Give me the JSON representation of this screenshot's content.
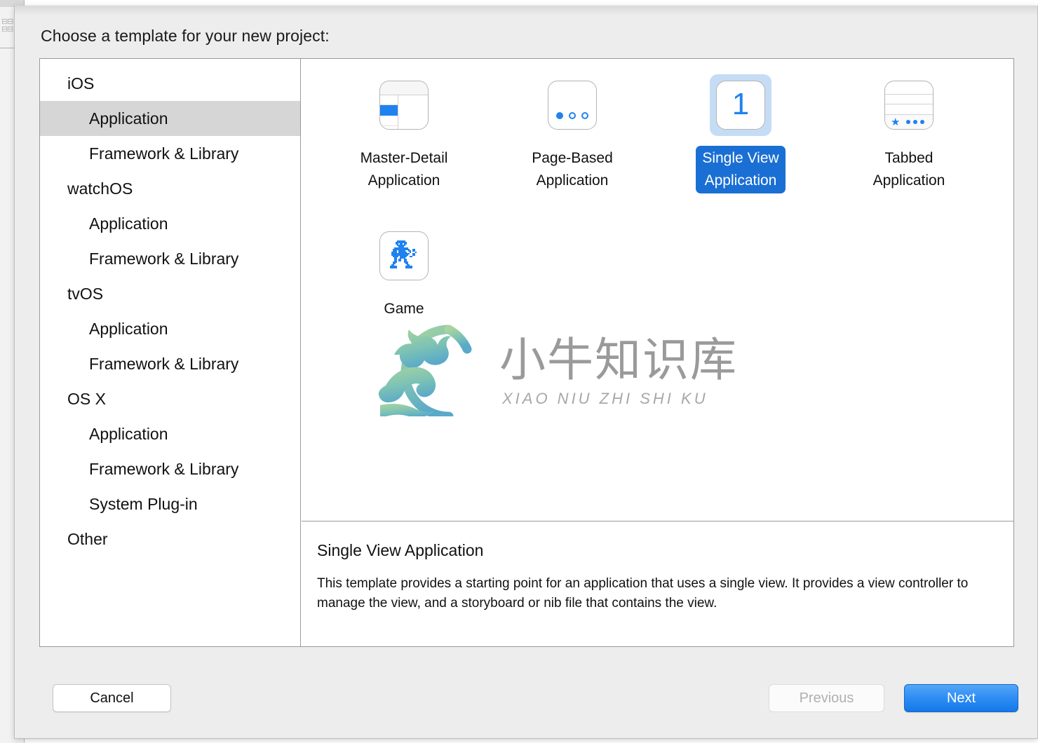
{
  "dialog": {
    "title": "Choose a template for your new project:"
  },
  "sidebar": {
    "items": [
      {
        "label": "iOS",
        "level": "group",
        "selected": false
      },
      {
        "label": "Application",
        "level": "child",
        "selected": true
      },
      {
        "label": "Framework & Library",
        "level": "child",
        "selected": false
      },
      {
        "label": "watchOS",
        "level": "group",
        "selected": false
      },
      {
        "label": "Application",
        "level": "child",
        "selected": false
      },
      {
        "label": "Framework & Library",
        "level": "child",
        "selected": false
      },
      {
        "label": "tvOS",
        "level": "group",
        "selected": false
      },
      {
        "label": "Application",
        "level": "child",
        "selected": false
      },
      {
        "label": "Framework & Library",
        "level": "child",
        "selected": false
      },
      {
        "label": "OS X",
        "level": "group",
        "selected": false
      },
      {
        "label": "Application",
        "level": "child",
        "selected": false
      },
      {
        "label": "Framework & Library",
        "level": "child",
        "selected": false
      },
      {
        "label": "System Plug-in",
        "level": "child",
        "selected": false
      },
      {
        "label": "Other",
        "level": "group",
        "selected": false
      }
    ]
  },
  "templates": [
    {
      "label": "Master-Detail\nApplication",
      "icon": "master-detail-icon",
      "selected": false
    },
    {
      "label": "Page-Based\nApplication",
      "icon": "page-based-icon",
      "selected": false
    },
    {
      "label": "Single View\nApplication",
      "icon": "single-view-icon",
      "selected": true
    },
    {
      "label": "Tabbed\nApplication",
      "icon": "tabbed-icon",
      "selected": false
    },
    {
      "label": "Game",
      "icon": "game-icon",
      "selected": false
    }
  ],
  "description": {
    "title": "Single View Application",
    "body": "This template provides a starting point for an application that uses a single view. It provides a view controller to manage the view, and a storyboard or nib file that contains the view."
  },
  "footer": {
    "cancel_label": "Cancel",
    "previous_label": "Previous",
    "next_label": "Next",
    "previous_disabled": true
  },
  "watermark": {
    "chinese": "小牛知识库",
    "pinyin": "XIAO NIU ZHI SHI KU"
  },
  "colors": {
    "accent_blue": "#1f82f0",
    "selected_label_blue": "#1a6fd4",
    "selected_icon_bg": "#c5dcf5",
    "sidebar_selected_bg": "#d6d6d6",
    "sheet_bg": "#ededed",
    "next_button_top": "#55a6f7",
    "next_button_bottom": "#1478e8",
    "watermark_green": "#a9d4a0",
    "watermark_blue": "#59a9c9"
  }
}
